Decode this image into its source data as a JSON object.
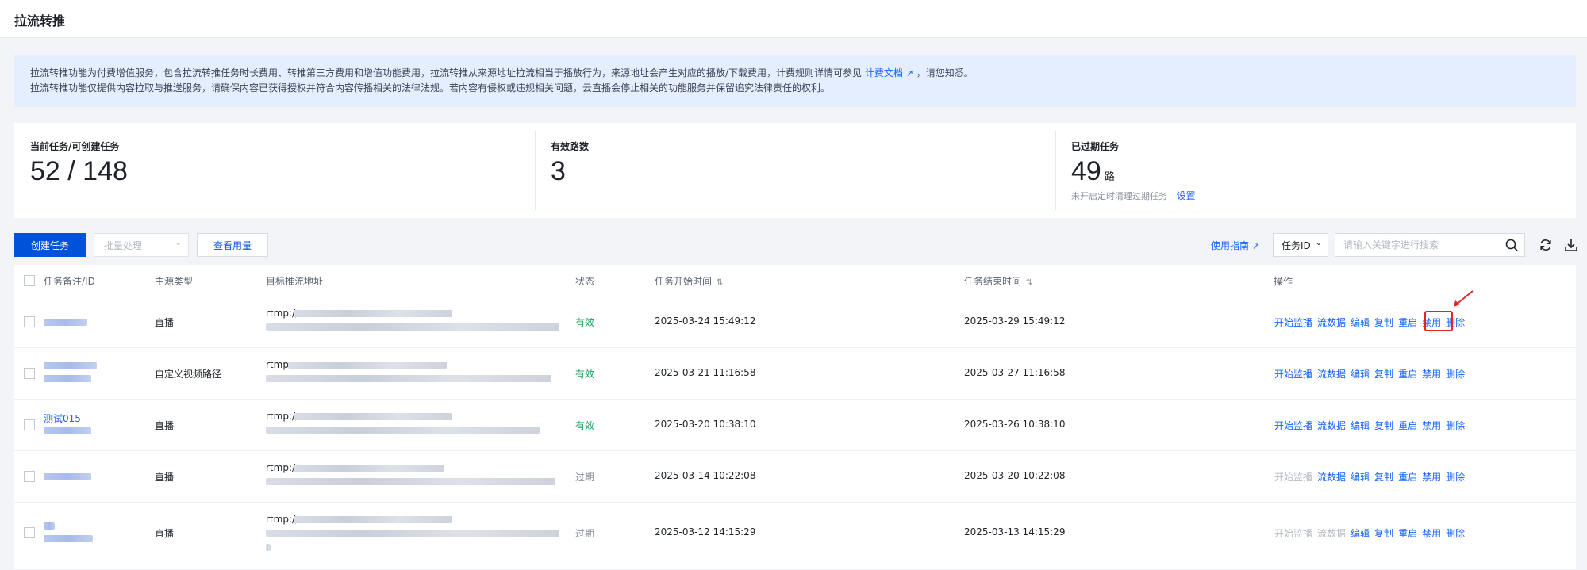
{
  "page": {
    "title": "拉流转推"
  },
  "notice": {
    "line1_a": "拉流转推功能为付费增值服务，包含拉流转推任务时长费用、转推第三方费用和增值功能费用，拉流转推从来源地址拉流相当于播放行为，来源地址会产生对应的播放/下载费用，计费规则详情可参见",
    "line1_link": "计费文档",
    "line1_b": "，请您知悉。",
    "line2": "拉流转推功能仅提供内容拉取与推送服务，请确保内容已获得授权并符合内容传播相关的法律法规。若内容有侵权或违规相关问题，云直播会停止相关的功能服务并保留追究法律责任的权利。"
  },
  "stats": {
    "current": {
      "label": "当前任务/可创建任务",
      "value": "52 / 148"
    },
    "valid": {
      "label": "有效路数",
      "value": "3"
    },
    "expired": {
      "label": "已过期任务",
      "value": "49",
      "unit": "路",
      "sub": "未开启定时清理过期任务",
      "sub_link": "设置"
    }
  },
  "toolbar": {
    "create_label": "创建任务",
    "batch_label": "批量处理",
    "usage_label": "查看用量",
    "guide_label": "使用指南",
    "search_key": "任务ID",
    "search_placeholder": "请输入关键字进行搜索"
  },
  "table": {
    "columns": {
      "name": "任务备注/ID",
      "source": "主源类型",
      "target": "目标推流地址",
      "status": "状态",
      "start": "任务开始时间",
      "end": "任务结束时间",
      "ops": "操作"
    },
    "rows": [
      {
        "name": "",
        "source": "直播",
        "target_prefix": "rtmp://",
        "status": "有效",
        "start": "2025-03-24 15:49:12",
        "end": "2025-03-29 15:49:12",
        "ops": [
          "开始监播",
          "流数据",
          "编辑",
          "复制",
          "重启",
          "禁用",
          "删除"
        ]
      },
      {
        "name": "",
        "source": "自定义视频路径",
        "target_prefix": "rtmp:",
        "status": "有效",
        "start": "2025-03-21 11:16:58",
        "end": "2025-03-27 11:16:58",
        "ops": [
          "开始监播",
          "流数据",
          "编辑",
          "复制",
          "重启",
          "禁用",
          "删除"
        ]
      },
      {
        "name": "测试015",
        "source": "直播",
        "target_prefix": "rtmp://",
        "status": "有效",
        "start": "2025-03-20 10:38:10",
        "end": "2025-03-26 10:38:10",
        "ops": [
          "开始监播",
          "流数据",
          "编辑",
          "复制",
          "重启",
          "禁用",
          "删除"
        ]
      },
      {
        "name": "",
        "source": "直播",
        "target_prefix": "rtmp://",
        "status": "过期",
        "start": "2025-03-14 10:22:08",
        "end": "2025-03-20 10:22:08",
        "ops": [
          "开始监播",
          "流数据",
          "编辑",
          "复制",
          "重启",
          "禁用",
          "删除"
        ]
      },
      {
        "name": "",
        "source": "直播",
        "target_prefix": "rtmp://",
        "status": "过期",
        "start": "2025-03-12 14:15:29",
        "end": "2025-03-13 14:15:29",
        "ops": [
          "开始监播",
          "流数据",
          "编辑",
          "复制",
          "重启",
          "禁用",
          "删除"
        ]
      }
    ]
  },
  "colors": {
    "primary": "#0052d9",
    "link": "#1664ff",
    "valid": "#19a05a",
    "highlight": "#e22424"
  }
}
